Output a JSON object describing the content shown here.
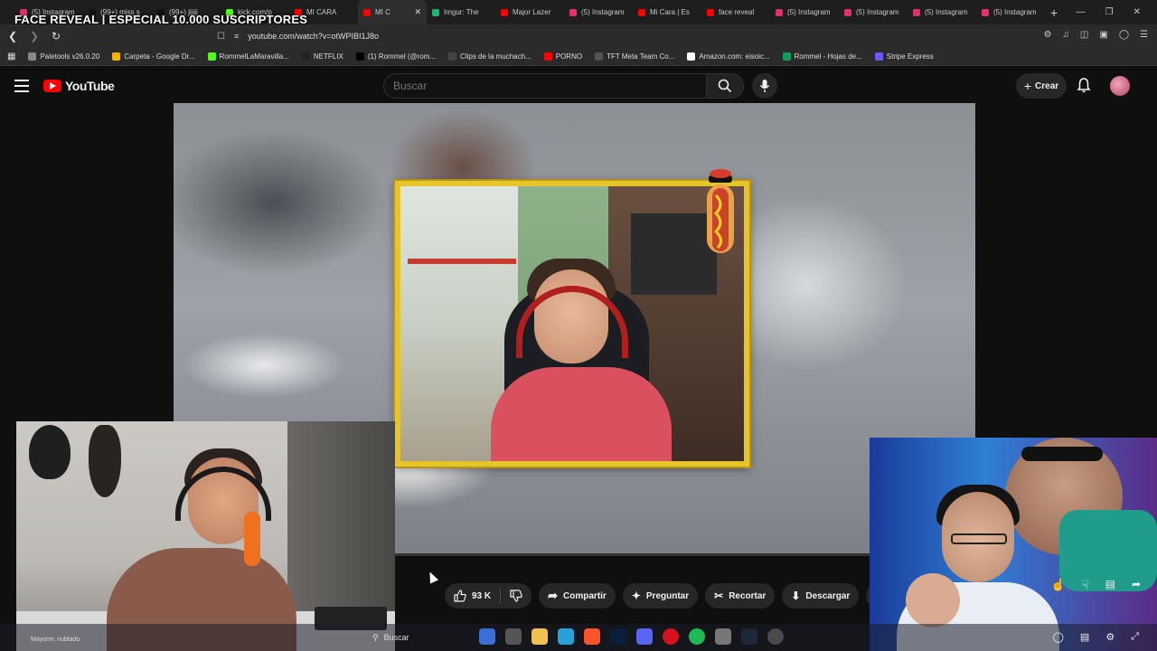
{
  "browser": {
    "tabs": [
      {
        "label": "(5) Instagram",
        "color": "#e1306c"
      },
      {
        "label": "(99+) miss s",
        "color": "#111111"
      },
      {
        "label": "(99+) jijiji",
        "color": "#111111"
      },
      {
        "label": "kick.com/p",
        "color": "#53fc18"
      },
      {
        "label": "MI CARA",
        "color": "#ff0000"
      },
      {
        "label": "MI C",
        "color": "#ff0000",
        "active": true
      },
      {
        "label": "Imgur: The",
        "color": "#1bb76e"
      },
      {
        "label": "Major Lazer",
        "color": "#ff0000"
      },
      {
        "label": "(5) Instagram",
        "color": "#e1306c"
      },
      {
        "label": "Mi Cara | Es",
        "color": "#ff0000"
      },
      {
        "label": "face reveal",
        "color": "#ff0000"
      },
      {
        "label": "(5) Instagram",
        "color": "#e1306c"
      },
      {
        "label": "(5) Instagram",
        "color": "#e1306c"
      },
      {
        "label": "(5) Instagram",
        "color": "#e1306c"
      },
      {
        "label": "(5) Instagram",
        "color": "#e1306c"
      }
    ],
    "new_tab": "+",
    "overlay_title": "FACE REVEAL | ESPECIAL 10.000 SUSCRIPTORES",
    "url": "youtube.com/watch?v=otWPIBI1J8o",
    "bookmarks": [
      {
        "label": "Paletools v26.0.20",
        "color": "#888888"
      },
      {
        "label": "Carpeta - Google Dr...",
        "color": "#f4b400"
      },
      {
        "label": "RommelLaMaravilla...",
        "color": "#53fc18"
      },
      {
        "label": "NETFLIX",
        "color": "#222222"
      },
      {
        "label": "(1) Rommel (@rom...",
        "color": "#000000"
      },
      {
        "label": "Clips de la muchach...",
        "color": "#444444"
      },
      {
        "label": "PORNO",
        "color": "#ff0000"
      },
      {
        "label": "TFT Meta Team Co...",
        "color": "#555555"
      },
      {
        "label": "Amazon.com: eisoic...",
        "color": "#ffffff"
      },
      {
        "label": "Rommel - Hojas de...",
        "color": "#0f9d58"
      },
      {
        "label": "Stripe Express",
        "color": "#635bff"
      }
    ]
  },
  "youtube": {
    "logo_text": "YouTube",
    "search_placeholder": "Buscar",
    "create_label": "Crear",
    "actions": {
      "likes": "93 K",
      "share": "Compartir",
      "ask": "Preguntar",
      "clip": "Recortar",
      "download": "Descargar"
    }
  },
  "taskbar": {
    "weather": "Mayorm. nublado",
    "search": "Buscar"
  },
  "colors": {
    "accent_red": "#ff0000",
    "frame_gold": "#e7c42a"
  }
}
